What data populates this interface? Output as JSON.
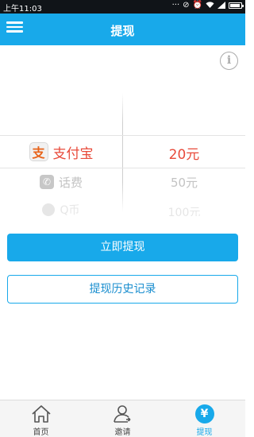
{
  "status_bar": {
    "time": "上午11:03"
  },
  "header": {
    "title": "提现"
  },
  "picker": {
    "methods": [
      {
        "label": "支付宝",
        "icon": "alipay-icon",
        "glyph": "支",
        "state": "selected"
      },
      {
        "label": "话费",
        "icon": "phone-icon",
        "glyph": "✆",
        "state": "near"
      },
      {
        "label": "Q币",
        "icon": "qq-icon",
        "state": "far"
      }
    ],
    "amounts": [
      {
        "label": "20元",
        "state": "selected"
      },
      {
        "label": "50元",
        "state": "near"
      },
      {
        "label": "100元",
        "state": "far"
      }
    ],
    "accent_color": "#e84a3a"
  },
  "actions": {
    "withdraw_label": "立即提现",
    "history_label": "提现历史记录"
  },
  "bottom_nav": [
    {
      "label": "首页",
      "icon": "home-icon",
      "active": false
    },
    {
      "label": "邀请",
      "icon": "invite-user-icon",
      "active": false
    },
    {
      "label": "提现",
      "icon": "yuan-icon",
      "active": true
    }
  ],
  "colors": {
    "brand": "#18a9ea"
  }
}
